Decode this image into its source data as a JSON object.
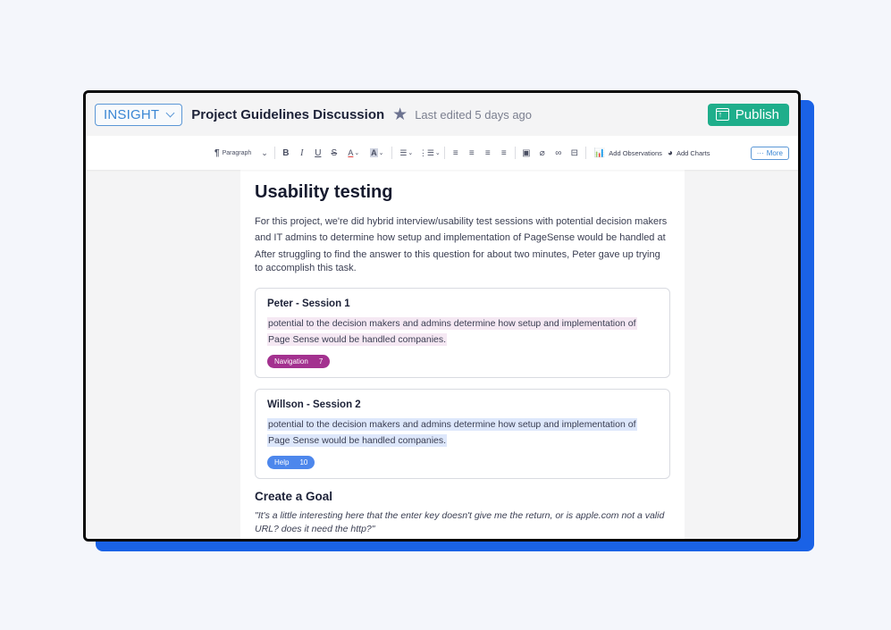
{
  "header": {
    "workspace_label": "INSIGHT",
    "doc_title": "Project Guidelines Discussion",
    "last_edited": "Last edited 5 days ago",
    "publish_label": "Publish"
  },
  "toolbar": {
    "paragraph_label": "Paragraph",
    "pilcrow": "¶",
    "bold": "B",
    "italic": "I",
    "underline": "U",
    "strike": "S",
    "text_color": "A",
    "highlight": "A",
    "add_observations": "Add Observations",
    "add_charts": "Add Charts",
    "more_label": "More",
    "more_dots": "···"
  },
  "document": {
    "title": "Usability testing",
    "paragraphs": [
      "For this project, we're did hybrid interview/usability test sessions with potential decision makers and IT admins to determine how setup and implementation of PageSense would be handled at",
      "After struggling to find the answer to this question for about two minutes, Peter gave up trying to accomplish this task."
    ],
    "sessions": [
      {
        "title": "Peter - Session 1",
        "text": "potential to the decision makers and admins determine how setup and implementation of Page Sense would be handled companies.",
        "tag_label": "Navigation",
        "tag_count": "7",
        "tag_color": "#a3318f",
        "highlight_color": "#f5e8f3"
      },
      {
        "title": "Willson - Session 2",
        "text": "potential to the decision makers and admins determine how setup and implementation of Page Sense would be handled companies.",
        "tag_label": "Help",
        "tag_count": "10",
        "tag_color": "#4d87ec",
        "highlight_color": "#dde7fb"
      }
    ],
    "goal_heading": "Create a Goal",
    "goal_quote": "\"It's a little interesting here that the enter key doesn't give me the return, or is apple.com not a valid URL? does it need the http?\""
  },
  "colors": {
    "accent_blue": "#1a62e6",
    "publish_green": "#1fae8b",
    "insight_blue": "#3a86d4"
  }
}
